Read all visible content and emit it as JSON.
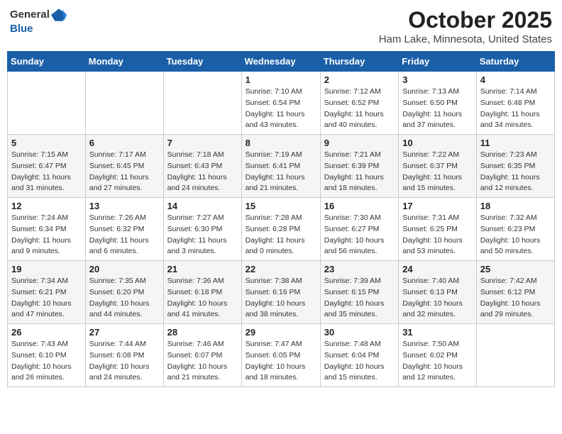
{
  "header": {
    "logo_general": "General",
    "logo_blue": "Blue",
    "title": "October 2025",
    "subtitle": "Ham Lake, Minnesota, United States"
  },
  "weekdays": [
    "Sunday",
    "Monday",
    "Tuesday",
    "Wednesday",
    "Thursday",
    "Friday",
    "Saturday"
  ],
  "weeks": [
    [
      {
        "day": "",
        "info": ""
      },
      {
        "day": "",
        "info": ""
      },
      {
        "day": "",
        "info": ""
      },
      {
        "day": "1",
        "info": "Sunrise: 7:10 AM\nSunset: 6:54 PM\nDaylight: 11 hours and 43 minutes."
      },
      {
        "day": "2",
        "info": "Sunrise: 7:12 AM\nSunset: 6:52 PM\nDaylight: 11 hours and 40 minutes."
      },
      {
        "day": "3",
        "info": "Sunrise: 7:13 AM\nSunset: 6:50 PM\nDaylight: 11 hours and 37 minutes."
      },
      {
        "day": "4",
        "info": "Sunrise: 7:14 AM\nSunset: 6:48 PM\nDaylight: 11 hours and 34 minutes."
      }
    ],
    [
      {
        "day": "5",
        "info": "Sunrise: 7:15 AM\nSunset: 6:47 PM\nDaylight: 11 hours and 31 minutes."
      },
      {
        "day": "6",
        "info": "Sunrise: 7:17 AM\nSunset: 6:45 PM\nDaylight: 11 hours and 27 minutes."
      },
      {
        "day": "7",
        "info": "Sunrise: 7:18 AM\nSunset: 6:43 PM\nDaylight: 11 hours and 24 minutes."
      },
      {
        "day": "8",
        "info": "Sunrise: 7:19 AM\nSunset: 6:41 PM\nDaylight: 11 hours and 21 minutes."
      },
      {
        "day": "9",
        "info": "Sunrise: 7:21 AM\nSunset: 6:39 PM\nDaylight: 11 hours and 18 minutes."
      },
      {
        "day": "10",
        "info": "Sunrise: 7:22 AM\nSunset: 6:37 PM\nDaylight: 11 hours and 15 minutes."
      },
      {
        "day": "11",
        "info": "Sunrise: 7:23 AM\nSunset: 6:35 PM\nDaylight: 11 hours and 12 minutes."
      }
    ],
    [
      {
        "day": "12",
        "info": "Sunrise: 7:24 AM\nSunset: 6:34 PM\nDaylight: 11 hours and 9 minutes."
      },
      {
        "day": "13",
        "info": "Sunrise: 7:26 AM\nSunset: 6:32 PM\nDaylight: 11 hours and 6 minutes."
      },
      {
        "day": "14",
        "info": "Sunrise: 7:27 AM\nSunset: 6:30 PM\nDaylight: 11 hours and 3 minutes."
      },
      {
        "day": "15",
        "info": "Sunrise: 7:28 AM\nSunset: 6:28 PM\nDaylight: 11 hours and 0 minutes."
      },
      {
        "day": "16",
        "info": "Sunrise: 7:30 AM\nSunset: 6:27 PM\nDaylight: 10 hours and 56 minutes."
      },
      {
        "day": "17",
        "info": "Sunrise: 7:31 AM\nSunset: 6:25 PM\nDaylight: 10 hours and 53 minutes."
      },
      {
        "day": "18",
        "info": "Sunrise: 7:32 AM\nSunset: 6:23 PM\nDaylight: 10 hours and 50 minutes."
      }
    ],
    [
      {
        "day": "19",
        "info": "Sunrise: 7:34 AM\nSunset: 6:21 PM\nDaylight: 10 hours and 47 minutes."
      },
      {
        "day": "20",
        "info": "Sunrise: 7:35 AM\nSunset: 6:20 PM\nDaylight: 10 hours and 44 minutes."
      },
      {
        "day": "21",
        "info": "Sunrise: 7:36 AM\nSunset: 6:18 PM\nDaylight: 10 hours and 41 minutes."
      },
      {
        "day": "22",
        "info": "Sunrise: 7:38 AM\nSunset: 6:16 PM\nDaylight: 10 hours and 38 minutes."
      },
      {
        "day": "23",
        "info": "Sunrise: 7:39 AM\nSunset: 6:15 PM\nDaylight: 10 hours and 35 minutes."
      },
      {
        "day": "24",
        "info": "Sunrise: 7:40 AM\nSunset: 6:13 PM\nDaylight: 10 hours and 32 minutes."
      },
      {
        "day": "25",
        "info": "Sunrise: 7:42 AM\nSunset: 6:12 PM\nDaylight: 10 hours and 29 minutes."
      }
    ],
    [
      {
        "day": "26",
        "info": "Sunrise: 7:43 AM\nSunset: 6:10 PM\nDaylight: 10 hours and 26 minutes."
      },
      {
        "day": "27",
        "info": "Sunrise: 7:44 AM\nSunset: 6:08 PM\nDaylight: 10 hours and 24 minutes."
      },
      {
        "day": "28",
        "info": "Sunrise: 7:46 AM\nSunset: 6:07 PM\nDaylight: 10 hours and 21 minutes."
      },
      {
        "day": "29",
        "info": "Sunrise: 7:47 AM\nSunset: 6:05 PM\nDaylight: 10 hours and 18 minutes."
      },
      {
        "day": "30",
        "info": "Sunrise: 7:48 AM\nSunset: 6:04 PM\nDaylight: 10 hours and 15 minutes."
      },
      {
        "day": "31",
        "info": "Sunrise: 7:50 AM\nSunset: 6:02 PM\nDaylight: 10 hours and 12 minutes."
      },
      {
        "day": "",
        "info": ""
      }
    ]
  ]
}
